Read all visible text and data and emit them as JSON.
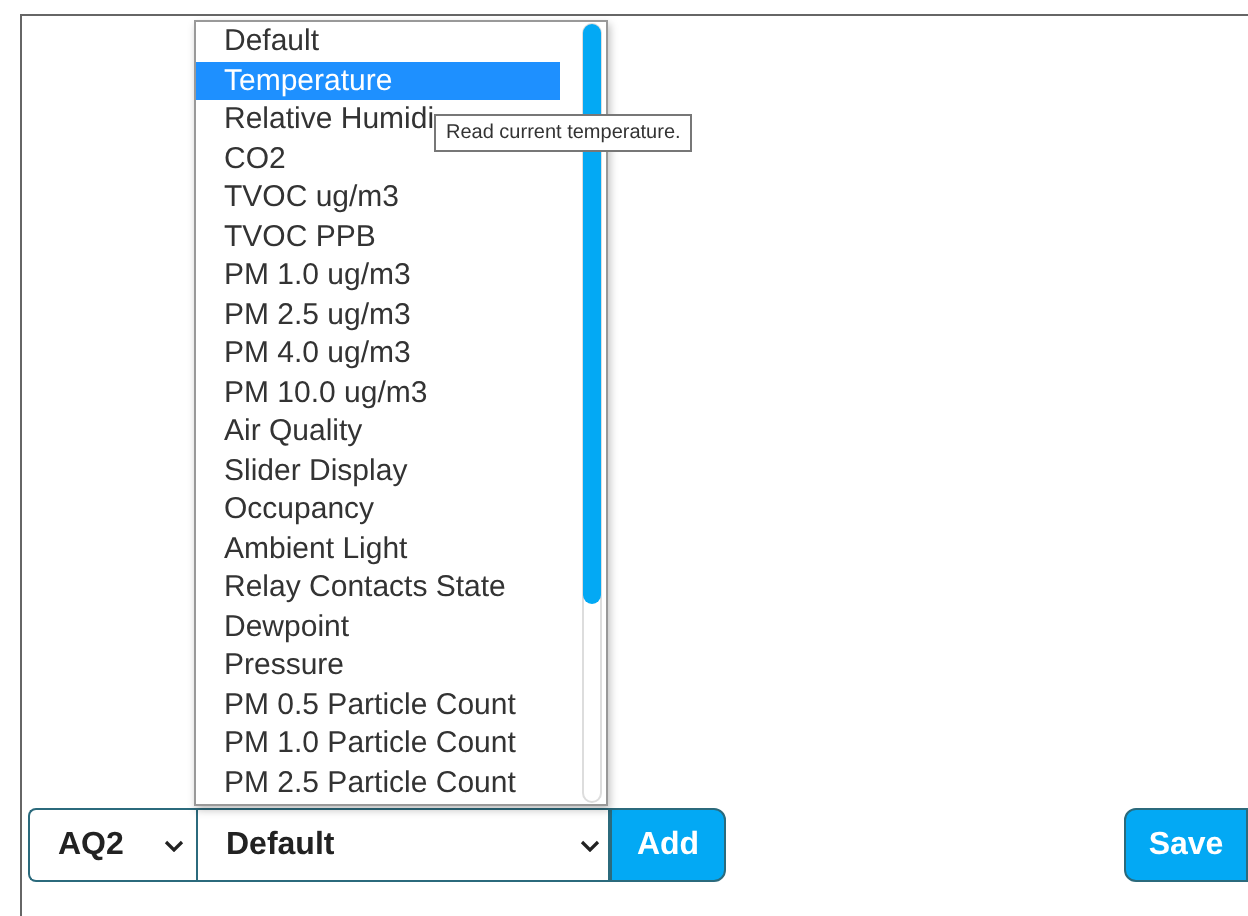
{
  "dropdown_list": {
    "items": [
      {
        "label": "Default",
        "selected": false
      },
      {
        "label": "Temperature",
        "selected": true
      },
      {
        "label": "Relative Humidi",
        "selected": false
      },
      {
        "label": "CO2",
        "selected": false
      },
      {
        "label": "TVOC ug/m3",
        "selected": false
      },
      {
        "label": "TVOC PPB",
        "selected": false
      },
      {
        "label": "PM 1.0 ug/m3",
        "selected": false
      },
      {
        "label": "PM 2.5 ug/m3",
        "selected": false
      },
      {
        "label": "PM 4.0 ug/m3",
        "selected": false
      },
      {
        "label": "PM 10.0 ug/m3",
        "selected": false
      },
      {
        "label": "Air Quality",
        "selected": false
      },
      {
        "label": "Slider Display",
        "selected": false
      },
      {
        "label": "Occupancy",
        "selected": false
      },
      {
        "label": "Ambient Light",
        "selected": false
      },
      {
        "label": "Relay Contacts State",
        "selected": false
      },
      {
        "label": "Dewpoint",
        "selected": false
      },
      {
        "label": "Pressure",
        "selected": false
      },
      {
        "label": "PM 0.5 Particle Count",
        "selected": false
      },
      {
        "label": "PM 1.0 Particle Count",
        "selected": false
      },
      {
        "label": "PM 2.5 Particle Count",
        "selected": false
      }
    ]
  },
  "tooltip": "Read current temperature.",
  "device_select": {
    "value": "AQ2"
  },
  "measurement_select": {
    "value": "Default"
  },
  "buttons": [
    {
      "label": "Add",
      "kind": "add"
    },
    {
      "label": "Save",
      "kind": "save"
    }
  ]
}
